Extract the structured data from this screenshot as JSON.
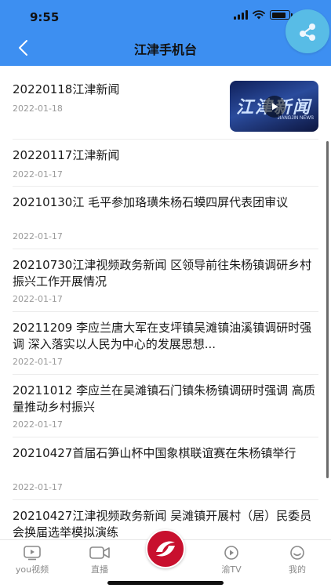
{
  "status_bar": {
    "time": "9:55"
  },
  "nav": {
    "title": "江津手机台"
  },
  "news": [
    {
      "title": "20220118江津新闻",
      "date": "2022-01-18",
      "has_thumbnail": true,
      "thumbnail_text": "江津新闻",
      "thumbnail_subtext": "JIANGJIN NEWS"
    },
    {
      "title": "20220117江津新闻",
      "date": "2022-01-17"
    },
    {
      "title": "20210130江 毛平参加珞璜朱杨石蟆四屏代表团审议",
      "date": "2022-01-17"
    },
    {
      "title": "20210730江津视频政务新闻 区领导前往朱杨镇调研乡村振兴工作开展情况",
      "date": "2022-01-17"
    },
    {
      "title": "20211209 李应兰唐大军在支坪镇吴滩镇油溪镇调研时强调 深入落实以人民为中心的发展思想...",
      "date": "2022-01-17"
    },
    {
      "title": "20211012 李应兰在吴滩镇石门镇朱杨镇调研时强调 高质量推动乡村振兴",
      "date": "2022-01-17"
    },
    {
      "title": "20210427首届石笋山杯中国象棋联谊赛在朱杨镇举行",
      "date": "2022-01-17"
    },
    {
      "title": "20210427江津视频政务新闻 吴滩镇开展村（居）民委员会换届选举模拟演练",
      "date": ""
    }
  ],
  "tabs": [
    {
      "label": "you视频",
      "icon": "video-play-icon"
    },
    {
      "label": "直播",
      "icon": "camera-icon"
    },
    {
      "label": "渝TV",
      "icon": "tv-play-icon"
    },
    {
      "label": "我的",
      "icon": "smiley-icon"
    }
  ],
  "colors": {
    "header": "#3d8ff1",
    "fab": "#5bc0e6",
    "logo": "#c8102e"
  }
}
